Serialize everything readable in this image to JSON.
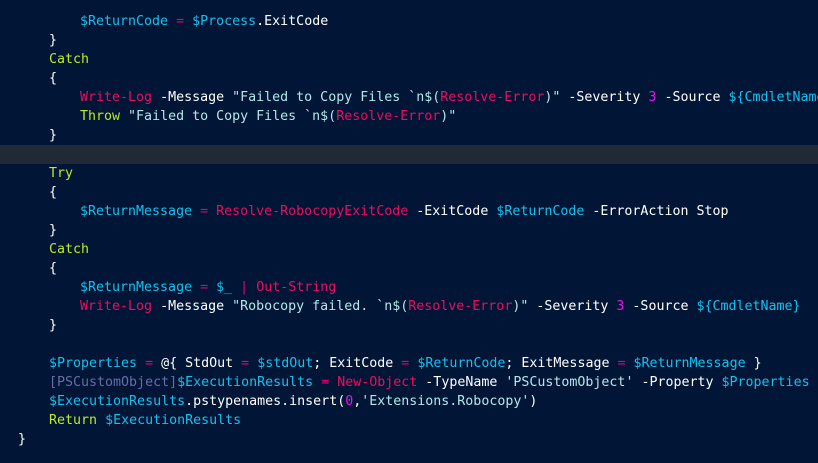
{
  "editor": {
    "language": "PowerShell",
    "colors": {
      "background": "#011537",
      "highlight": "#1f2a36",
      "variable": "#16c1ec",
      "operator": "#e60074",
      "keyword": "#bdec22",
      "command": "#ec0d5d",
      "string": "#b2e8e9",
      "number": "#ea12ea",
      "type": "#686ba9",
      "text": "#ffffff"
    },
    "lines": [
      {
        "tokens": [
          {
            "t": "$ReturnCode",
            "c": "var"
          },
          {
            "t": " ",
            "c": "plain"
          },
          {
            "t": "=",
            "c": "op"
          },
          {
            "t": " ",
            "c": "plain"
          },
          {
            "t": "$Process",
            "c": "var"
          },
          {
            "t": ".ExitCode",
            "c": "plain"
          }
        ]
      },
      {
        "tokens": [
          {
            "t": "}",
            "c": "brace"
          }
        ]
      },
      {
        "tokens": [
          {
            "t": "Catch",
            "c": "kw"
          }
        ]
      },
      {
        "tokens": [
          {
            "t": "{",
            "c": "brace"
          }
        ]
      },
      {
        "tokens": [
          {
            "t": "Write-Log",
            "c": "cmd"
          },
          {
            "t": " -Message ",
            "c": "plain"
          },
          {
            "t": "\"Failed to Copy Files `n$(",
            "c": "str"
          },
          {
            "t": "Resolve-Error",
            "c": "cmd"
          },
          {
            "t": ")\"",
            "c": "str"
          },
          {
            "t": " -Severity ",
            "c": "plain"
          },
          {
            "t": "3",
            "c": "num"
          },
          {
            "t": " -Source ",
            "c": "plain"
          },
          {
            "t": "${CmdletName}",
            "c": "var"
          }
        ]
      },
      {
        "tokens": [
          {
            "t": "Throw",
            "c": "kw"
          },
          {
            "t": " ",
            "c": "plain"
          },
          {
            "t": "\"Failed to Copy Files `n$(",
            "c": "str"
          },
          {
            "t": "Resolve-Error",
            "c": "cmd"
          },
          {
            "t": ")\"",
            "c": "str"
          }
        ]
      },
      {
        "tokens": [
          {
            "t": "}",
            "c": "brace"
          }
        ]
      },
      {
        "tokens": []
      },
      {
        "tokens": []
      },
      {
        "tokens": [
          {
            "t": "Try",
            "c": "kw"
          }
        ]
      },
      {
        "tokens": [
          {
            "t": "{",
            "c": "brace"
          }
        ]
      },
      {
        "tokens": [
          {
            "t": "$ReturnMessage",
            "c": "var"
          },
          {
            "t": " ",
            "c": "plain"
          },
          {
            "t": "=",
            "c": "op"
          },
          {
            "t": " ",
            "c": "plain"
          },
          {
            "t": "Resolve-RobocopyExitCode",
            "c": "cmd"
          },
          {
            "t": " -ExitCode ",
            "c": "plain"
          },
          {
            "t": "$ReturnCode",
            "c": "var"
          },
          {
            "t": " -ErrorAction Stop",
            "c": "plain"
          }
        ]
      },
      {
        "tokens": [
          {
            "t": "}",
            "c": "brace"
          }
        ]
      },
      {
        "tokens": [
          {
            "t": "Catch",
            "c": "kw"
          }
        ]
      },
      {
        "tokens": [
          {
            "t": "{",
            "c": "brace"
          }
        ]
      },
      {
        "tokens": [
          {
            "t": "$ReturnMessage",
            "c": "var"
          },
          {
            "t": " ",
            "c": "plain"
          },
          {
            "t": "=",
            "c": "op"
          },
          {
            "t": " ",
            "c": "plain"
          },
          {
            "t": "$_",
            "c": "var"
          },
          {
            "t": " ",
            "c": "plain"
          },
          {
            "t": "|",
            "c": "op"
          },
          {
            "t": " ",
            "c": "plain"
          },
          {
            "t": "Out-String",
            "c": "cmd"
          }
        ]
      },
      {
        "tokens": [
          {
            "t": "Write-Log",
            "c": "cmd"
          },
          {
            "t": " -Message ",
            "c": "plain"
          },
          {
            "t": "\"Robocopy failed. `n$(",
            "c": "str"
          },
          {
            "t": "Resolve-Error",
            "c": "cmd"
          },
          {
            "t": ")\"",
            "c": "str"
          },
          {
            "t": " -Severity ",
            "c": "plain"
          },
          {
            "t": "3",
            "c": "num"
          },
          {
            "t": " -Source ",
            "c": "plain"
          },
          {
            "t": "${CmdletName}",
            "c": "var"
          }
        ]
      },
      {
        "tokens": [
          {
            "t": "}",
            "c": "brace"
          }
        ]
      },
      {
        "tokens": []
      },
      {
        "tokens": [
          {
            "t": "$Properties",
            "c": "var"
          },
          {
            "t": " ",
            "c": "plain"
          },
          {
            "t": "=",
            "c": "op"
          },
          {
            "t": " @{ StdOut ",
            "c": "plain"
          },
          {
            "t": "=",
            "c": "op"
          },
          {
            "t": " ",
            "c": "plain"
          },
          {
            "t": "$stdOut",
            "c": "var"
          },
          {
            "t": "; ExitCode ",
            "c": "plain"
          },
          {
            "t": "=",
            "c": "op"
          },
          {
            "t": " ",
            "c": "plain"
          },
          {
            "t": "$ReturnCode",
            "c": "var"
          },
          {
            "t": "; ExitMessage ",
            "c": "plain"
          },
          {
            "t": "=",
            "c": "op"
          },
          {
            "t": " ",
            "c": "plain"
          },
          {
            "t": "$ReturnMessage",
            "c": "var"
          },
          {
            "t": " }",
            "c": "plain"
          }
        ]
      },
      {
        "tokens": [
          {
            "t": "[PSCustomObject]",
            "c": "type"
          },
          {
            "t": "$ExecutionResults",
            "c": "var"
          },
          {
            "t": " ",
            "c": "plain"
          },
          {
            "t": "=",
            "c": "op"
          },
          {
            "t": " ",
            "c": "plain"
          },
          {
            "t": "New-Object",
            "c": "cmd"
          },
          {
            "t": " -TypeName ",
            "c": "plain"
          },
          {
            "t": "'PSCustomObject'",
            "c": "str"
          },
          {
            "t": " -Property ",
            "c": "plain"
          },
          {
            "t": "$Properties",
            "c": "var"
          }
        ]
      },
      {
        "tokens": [
          {
            "t": "$ExecutionResults",
            "c": "var"
          },
          {
            "t": ".pstypenames.insert(",
            "c": "plain"
          },
          {
            "t": "0",
            "c": "num"
          },
          {
            "t": ",",
            "c": "plain"
          },
          {
            "t": "'Extensions.Robocopy'",
            "c": "str"
          },
          {
            "t": ")",
            "c": "plain"
          }
        ]
      },
      {
        "tokens": [
          {
            "t": "Return",
            "c": "kw"
          },
          {
            "t": " ",
            "c": "plain"
          },
          {
            "t": "$ExecutionResults",
            "c": "var"
          }
        ]
      },
      {
        "tokens": [
          {
            "t": "}",
            "c": "brace"
          }
        ]
      }
    ]
  }
}
